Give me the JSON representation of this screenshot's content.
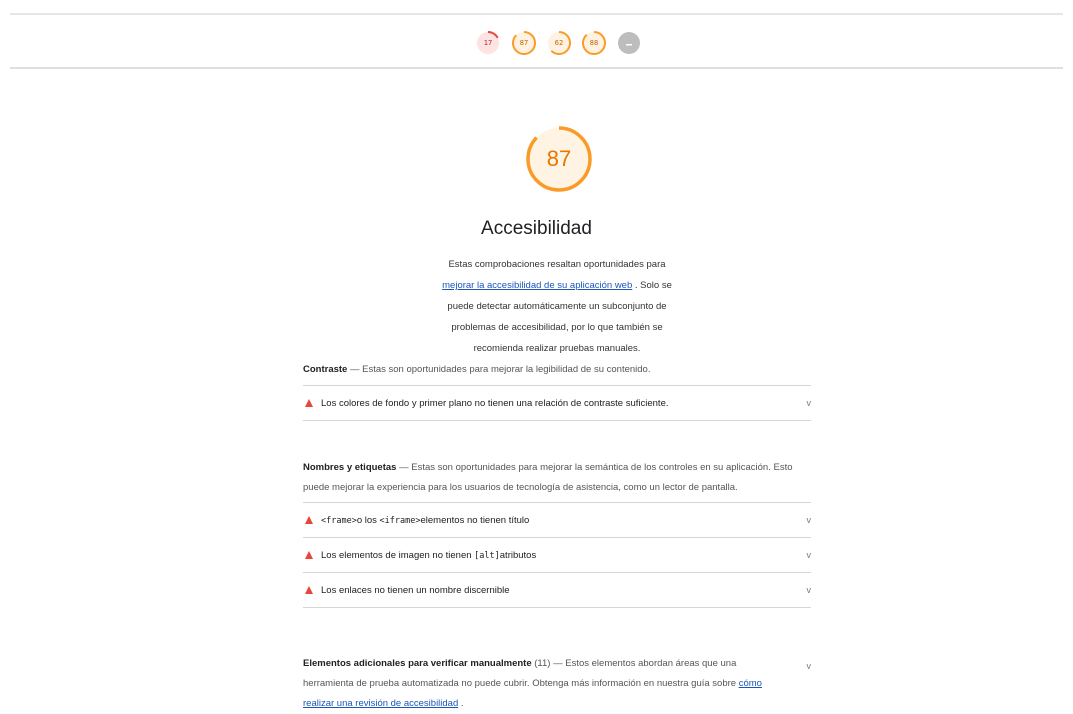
{
  "nav": {
    "scores": [
      {
        "value": "17",
        "color": "#e8453c",
        "fill": "#fde3e1",
        "fraction": 0.17,
        "text_color": "#c5221f"
      },
      {
        "value": "87",
        "color": "#fa9b27",
        "fill": "#fff2e0",
        "fraction": 0.87,
        "text_color": "#c26400"
      },
      {
        "value": "62",
        "color": "#fa9b27",
        "fill": "#fff2e0",
        "fraction": 0.62,
        "text_color": "#c26400"
      },
      {
        "value": "88",
        "color": "#fa9b27",
        "fill": "#fff2e0",
        "fraction": 0.88,
        "text_color": "#c26400"
      },
      {
        "value": "",
        "color": "#bdbdbd",
        "fill": "#bdbdbd",
        "fraction": 0,
        "text_color": "#ffffff",
        "pwa": true
      }
    ]
  },
  "category": {
    "score": "87",
    "score_fraction": 0.87,
    "title": "Accesibilidad",
    "desc_before": "Estas comprobaciones resaltan oportunidades para",
    "desc_link": "mejorar la accesibilidad de su aplicación web",
    "desc_after": ". Solo se puede detectar automáticamente un subconjunto de problemas de accesibilidad, por lo que también se recomienda realizar pruebas manuales."
  },
  "groups": {
    "contrast": {
      "title": "Contraste",
      "description": " — Estas son oportunidades para mejorar la legibilidad de su contenido.",
      "audits": [
        {
          "label": "Los colores de fondo y primer plano no tienen una relación de contraste suficiente."
        }
      ]
    },
    "names": {
      "title": "Nombres y etiquetas",
      "description": " — Estas son oportunidades para mejorar la semántica de los controles en su aplicación. Esto puede mejorar la experiencia para los usuarios de tecnología de asistencia, como un lector de pantalla.",
      "audit_frame": {
        "code1": "<frame>",
        "mid": "o los ",
        "code2": "<iframe>",
        "end": "elementos no tienen título"
      },
      "audit_img": {
        "pre": "Los elementos de imagen no tienen ",
        "code": "[alt]",
        "end": "atributos"
      },
      "audit_links": {
        "label": "Los enlaces no tienen un nombre discernible"
      }
    },
    "manual": {
      "title": "Elementos adicionales para verificar manualmente",
      "count": " (11)",
      "description": " — Estos elementos abordan áreas que una herramienta de prueba automatizada no puede cubrir. Obtenga más información en nuestra guía sobre ",
      "link": "cómo realizar una revisión de accesibilidad",
      "end": " ."
    }
  },
  "chevron": "v"
}
